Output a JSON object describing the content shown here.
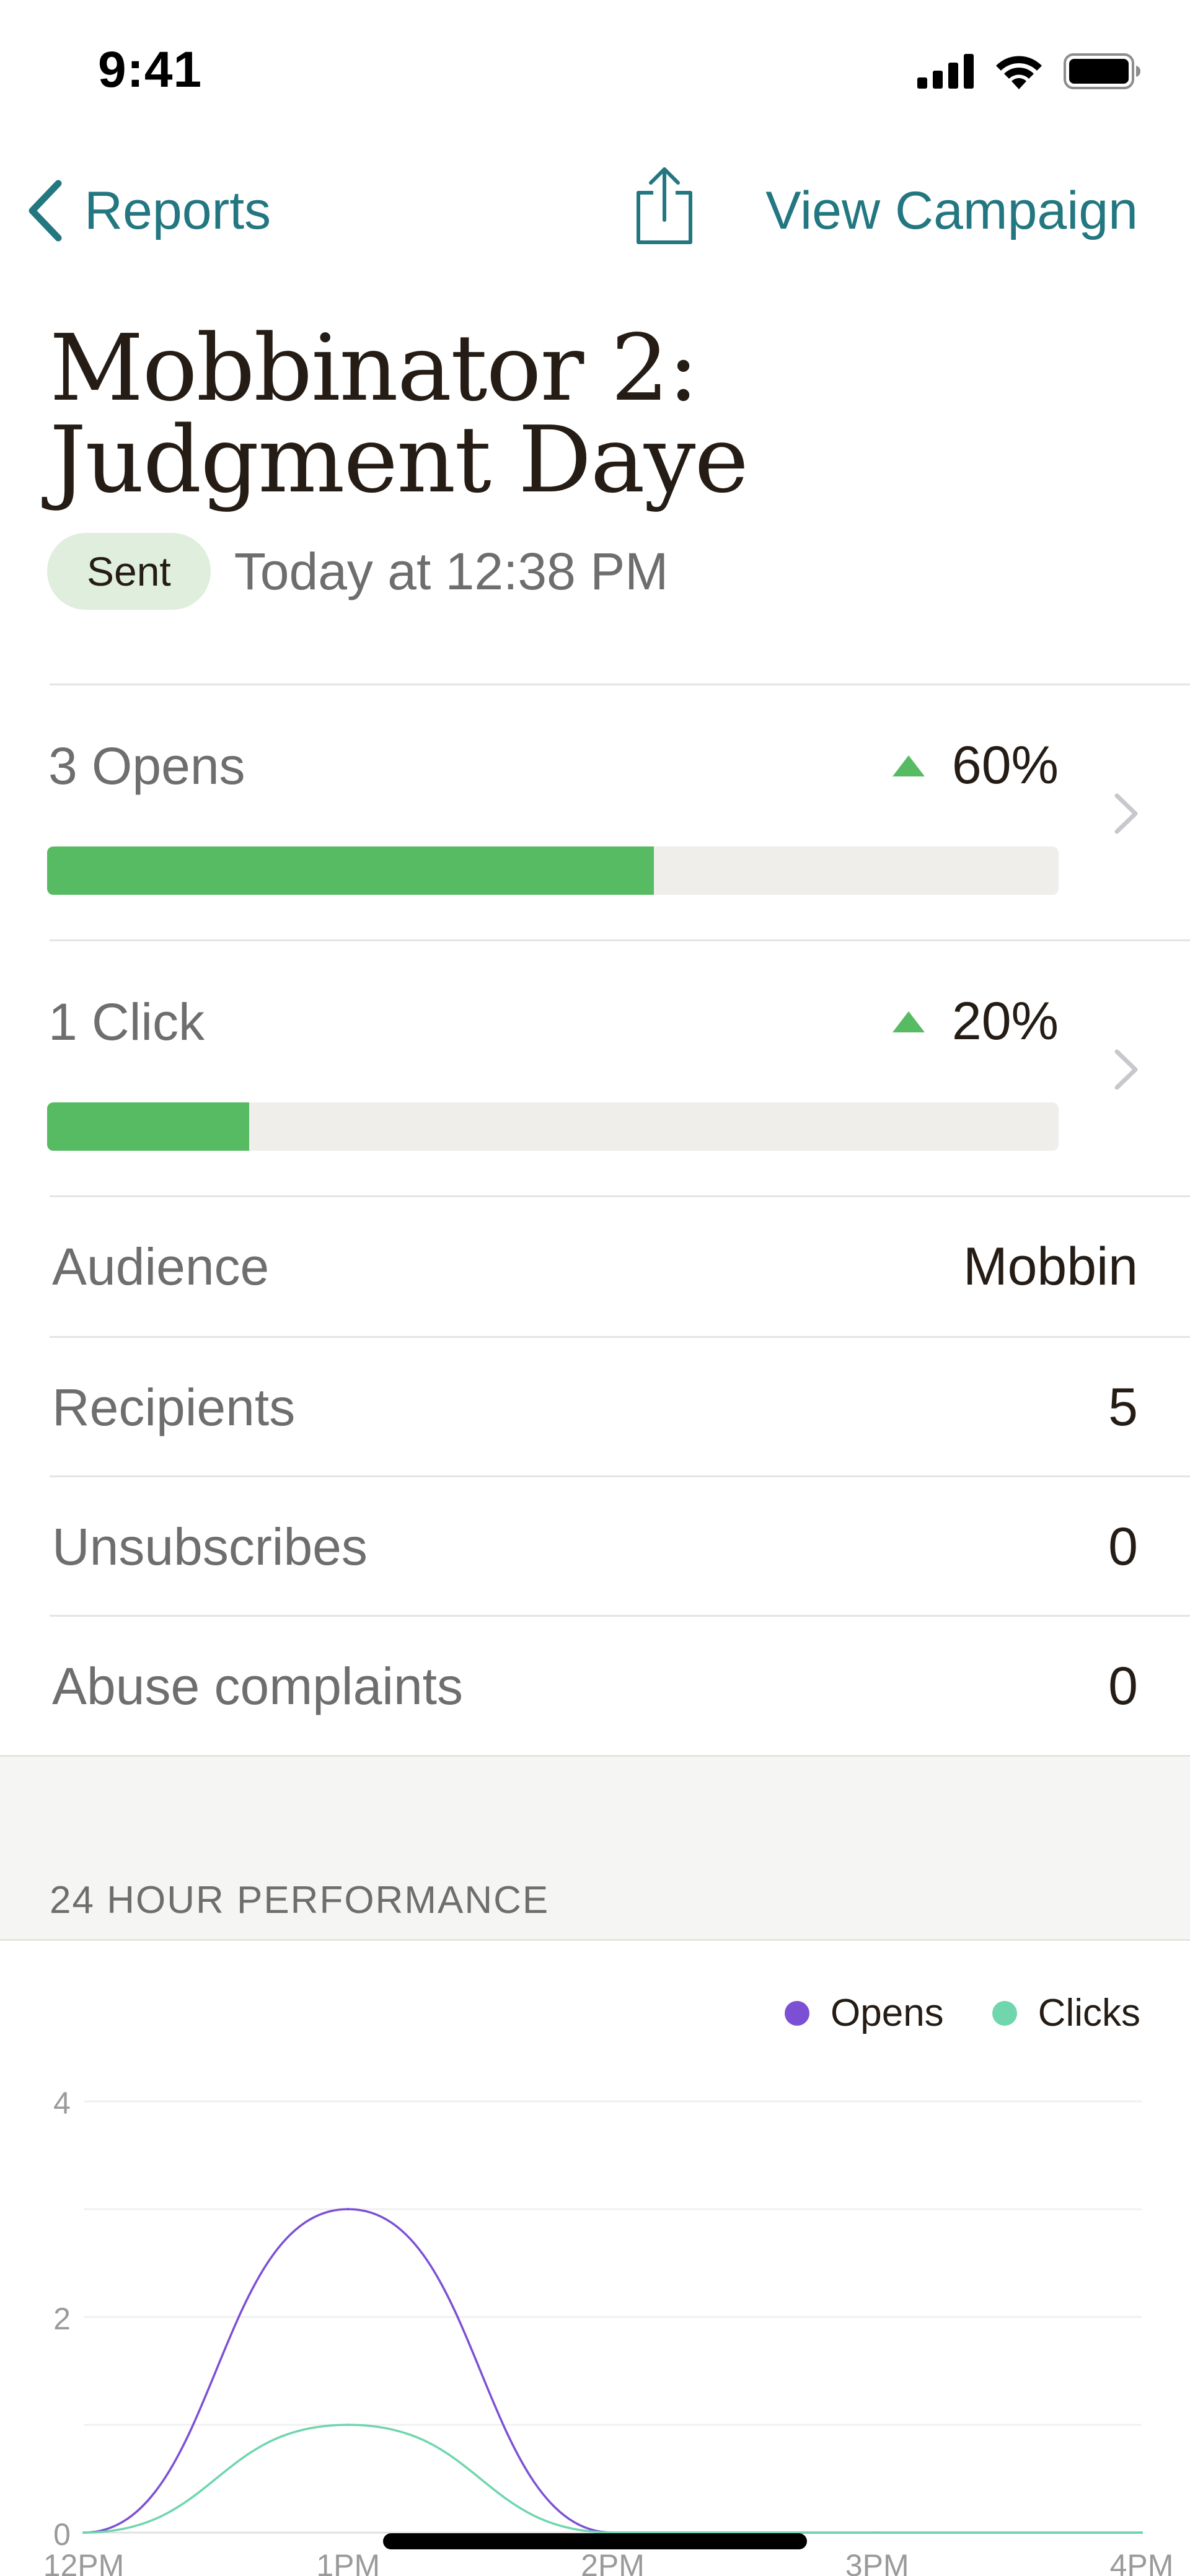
{
  "status_bar": {
    "time": "9:41"
  },
  "nav": {
    "back_label": "Reports",
    "share_icon": "share-icon",
    "view_campaign_label": "View Campaign"
  },
  "campaign": {
    "title_line1": "Mobbinator 2:",
    "title_line2": "Judgment Daye",
    "status_badge": "Sent",
    "sent_time": "Today at 12:38 PM"
  },
  "metrics": [
    {
      "label": "3 Opens",
      "change": "60%",
      "rate": 0.6,
      "trend": "up"
    },
    {
      "label": "1 Click",
      "change": "20%",
      "rate": 0.2,
      "trend": "up"
    }
  ],
  "stats": [
    {
      "label": "Audience",
      "value": "Mobbin"
    },
    {
      "label": "Recipients",
      "value": "5"
    },
    {
      "label": "Unsubscribes",
      "value": "0"
    },
    {
      "label": "Abuse complaints",
      "value": "0"
    }
  ],
  "section": {
    "performance_header": "24 HOUR PERFORMANCE"
  },
  "colors": {
    "accent": "#237781",
    "positive": "#56bb62",
    "opens": "#7c50d4",
    "clicks": "#6fd6ad"
  },
  "chart_data": {
    "type": "line",
    "title": "",
    "xlabel": "",
    "ylabel": "",
    "x_tick_labels": [
      "12PM",
      "1PM",
      "2PM",
      "3PM",
      "4PM"
    ],
    "x": [
      0,
      1,
      2,
      3,
      4
    ],
    "ylim": [
      0,
      4
    ],
    "y_ticks": [
      0,
      2,
      4
    ],
    "grid": true,
    "legend_position": "top-right",
    "series": [
      {
        "name": "Opens",
        "color": "#7c50d4",
        "values": [
          0,
          3,
          0,
          0,
          0
        ]
      },
      {
        "name": "Clicks",
        "color": "#6fd6ad",
        "values": [
          0,
          1,
          0,
          0,
          0
        ]
      }
    ]
  }
}
